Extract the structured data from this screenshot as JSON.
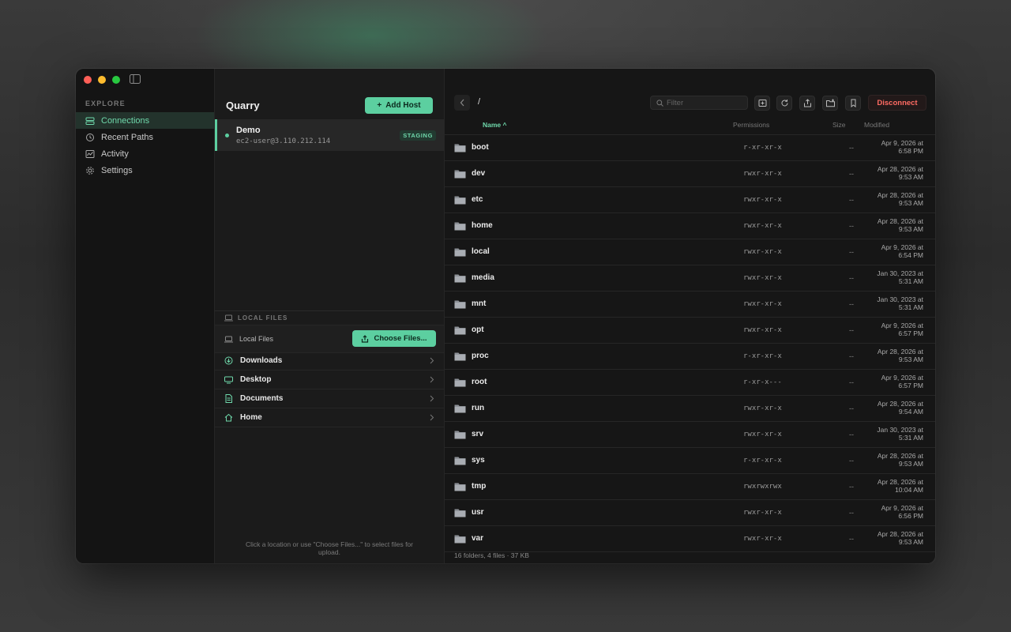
{
  "sidebar": {
    "section_label": "EXPLORE",
    "items": [
      {
        "label": "Connections",
        "icon": "connections-icon",
        "active": true
      },
      {
        "label": "Recent Paths",
        "icon": "clock-icon",
        "active": false
      },
      {
        "label": "Activity",
        "icon": "activity-icon",
        "active": false
      },
      {
        "label": "Settings",
        "icon": "gear-icon",
        "active": false
      }
    ]
  },
  "hosts": {
    "title": "Quarry",
    "add_label": "Add Host",
    "items": [
      {
        "name": "Demo",
        "address": "ec2-user@3.110.212.114",
        "badge": "STAGING"
      }
    ]
  },
  "local": {
    "section_label": "LOCAL FILES",
    "bar_label": "Local Files",
    "choose_label": "Choose Files...",
    "locations": [
      {
        "label": "Downloads",
        "icon": "download-icon"
      },
      {
        "label": "Desktop",
        "icon": "desktop-icon"
      },
      {
        "label": "Documents",
        "icon": "document-icon"
      },
      {
        "label": "Home",
        "icon": "home-icon"
      }
    ],
    "hint": "Click a location or use \"Choose Files...\" to select files for upload."
  },
  "browser": {
    "path": "/",
    "filter_placeholder": "Filter",
    "disconnect_label": "Disconnect",
    "columns": {
      "name": "Name ^",
      "permissions": "Permissions",
      "size": "Size",
      "modified": "Modified"
    },
    "rows": [
      {
        "name": "boot",
        "perm": "r-xr-xr-x",
        "size": "--",
        "mod1": "Apr 9, 2026 at",
        "mod2": "6:58 PM"
      },
      {
        "name": "dev",
        "perm": "rwxr-xr-x",
        "size": "--",
        "mod1": "Apr 28, 2026 at",
        "mod2": "9:53 AM"
      },
      {
        "name": "etc",
        "perm": "rwxr-xr-x",
        "size": "--",
        "mod1": "Apr 28, 2026 at",
        "mod2": "9:53 AM"
      },
      {
        "name": "home",
        "perm": "rwxr-xr-x",
        "size": "--",
        "mod1": "Apr 28, 2026 at",
        "mod2": "9:53 AM"
      },
      {
        "name": "local",
        "perm": "rwxr-xr-x",
        "size": "--",
        "mod1": "Apr 9, 2026 at",
        "mod2": "6:54 PM"
      },
      {
        "name": "media",
        "perm": "rwxr-xr-x",
        "size": "--",
        "mod1": "Jan 30, 2023 at",
        "mod2": "5:31 AM"
      },
      {
        "name": "mnt",
        "perm": "rwxr-xr-x",
        "size": "--",
        "mod1": "Jan 30, 2023 at",
        "mod2": "5:31 AM"
      },
      {
        "name": "opt",
        "perm": "rwxr-xr-x",
        "size": "--",
        "mod1": "Apr 9, 2026 at",
        "mod2": "6:57 PM"
      },
      {
        "name": "proc",
        "perm": "r-xr-xr-x",
        "size": "--",
        "mod1": "Apr 28, 2026 at",
        "mod2": "9:53 AM"
      },
      {
        "name": "root",
        "perm": "r-xr-x---",
        "size": "--",
        "mod1": "Apr 9, 2026 at",
        "mod2": "6:57 PM"
      },
      {
        "name": "run",
        "perm": "rwxr-xr-x",
        "size": "--",
        "mod1": "Apr 28, 2026 at",
        "mod2": "9:54 AM"
      },
      {
        "name": "srv",
        "perm": "rwxr-xr-x",
        "size": "--",
        "mod1": "Jan 30, 2023 at",
        "mod2": "5:31 AM"
      },
      {
        "name": "sys",
        "perm": "r-xr-xr-x",
        "size": "--",
        "mod1": "Apr 28, 2026 at",
        "mod2": "9:53 AM"
      },
      {
        "name": "tmp",
        "perm": "rwxrwxrwx",
        "size": "--",
        "mod1": "Apr 28, 2026 at",
        "mod2": "10:04 AM"
      },
      {
        "name": "usr",
        "perm": "rwxr-xr-x",
        "size": "--",
        "mod1": "Apr 9, 2026 at",
        "mod2": "6:56 PM"
      },
      {
        "name": "var",
        "perm": "rwxr-xr-x",
        "size": "--",
        "mod1": "Apr 28, 2026 at",
        "mod2": "9:53 AM"
      }
    ],
    "status": "16 folders, 4 files  ·  37  KB"
  },
  "colors": {
    "accent": "#5ccfa0",
    "danger": "#ff6b63",
    "window_bg": "#161616"
  }
}
